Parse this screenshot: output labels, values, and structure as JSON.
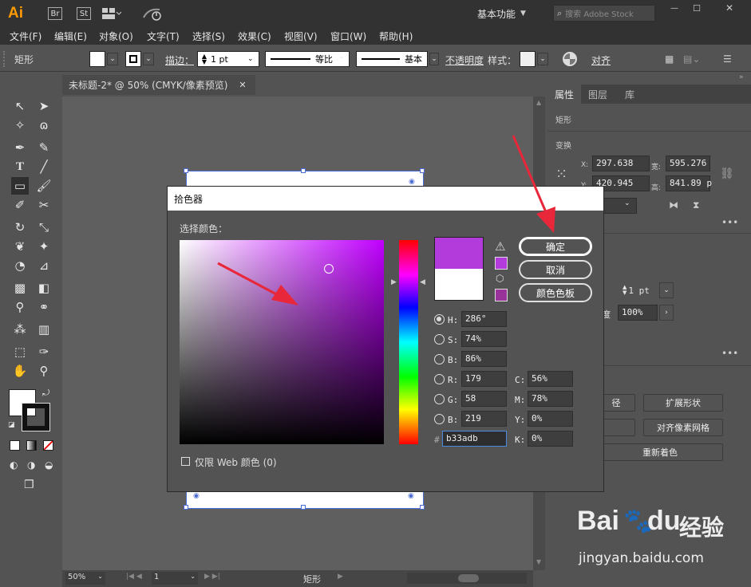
{
  "titlebar": {
    "app_logo": "Ai",
    "bridge": "Br",
    "stock_btn": "St",
    "workspace": "基本功能",
    "search_placeholder": "搜索 Adobe Stock",
    "win_min": "—",
    "win_max": "☐",
    "win_close": "✕"
  },
  "menu": [
    "文件(F)",
    "编辑(E)",
    "对象(O)",
    "文字(T)",
    "选择(S)",
    "效果(C)",
    "视图(V)",
    "窗口(W)",
    "帮助(H)"
  ],
  "control": {
    "object": "矩形",
    "stroke_label": "描边：",
    "stroke_value": "1 pt",
    "profile": "等比",
    "brush": "基本",
    "opacity_label": "不透明度",
    "style_label": "样式：",
    "align_label": "对齐"
  },
  "doc_tab": {
    "title": "未标题-2* @ 50% (CMYK/像素预览)",
    "close": "✕"
  },
  "status": {
    "zoom": "50%",
    "page": "1",
    "tool": "矩形"
  },
  "right_panel": {
    "tabs": [
      "属性",
      "图层",
      "库"
    ],
    "section_object": "矩形",
    "section_transform": "变换",
    "x_label": "X:",
    "x_value": "297.638",
    "y_label": "Y:",
    "y_value": "420.945",
    "w_label": "宽:",
    "w_value": "595.276",
    "h_label": "高:",
    "h_value": "841.89 p",
    "more1": "•••",
    "stroke_val": "1 pt",
    "opacity_suffix": "度",
    "opacity_val": "100%",
    "more2": "•••",
    "btn_path": "径",
    "btn_expand": "扩展形状",
    "btn_align_pixel": "对齐像素网格",
    "btn_recolor": "重新着色"
  },
  "dialog": {
    "title": "拾色器",
    "select_label": "选择颜色：",
    "ok": "确定",
    "cancel": "取消",
    "swatches": "颜色色板",
    "web_only": "仅限 Web 颜色 (0)",
    "fields": {
      "H": {
        "label": "H:",
        "value": "286°"
      },
      "S": {
        "label": "S:",
        "value": "74%"
      },
      "B": {
        "label": "B:",
        "value": "86%"
      },
      "R": {
        "label": "R:",
        "value": "179"
      },
      "G": {
        "label": "G:",
        "value": "58"
      },
      "B2": {
        "label": "B:",
        "value": "219"
      },
      "C": {
        "label": "C:",
        "value": "56%"
      },
      "M": {
        "label": "M:",
        "value": "78%"
      },
      "Y": {
        "label": "Y:",
        "value": "0%"
      },
      "K": {
        "label": "K:",
        "value": "0%"
      },
      "hex_label": "#",
      "hex": "b33adb"
    },
    "colors": {
      "new": "#b33adb",
      "old": "#ffffff",
      "hue": "#c000ff",
      "websafe": "#993399"
    }
  },
  "watermark": {
    "brand_left": "Bai",
    "brand_mid": "du",
    "brand_right": "经验",
    "url": "jingyan.baidu.com"
  },
  "colors": {
    "ui_dark": "#323232",
    "ui_mid": "#535353",
    "accent_red": "#e8273a"
  }
}
